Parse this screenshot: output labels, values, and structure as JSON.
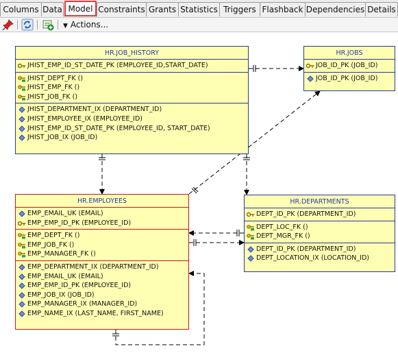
{
  "tabs": [
    "Columns",
    "Data",
    "Model",
    "Constraints",
    "Grants",
    "Statistics",
    "Triggers",
    "Flashback",
    "Dependencies",
    "Details"
  ],
  "toolbar": {
    "actions_label": "Actions...",
    "icons": [
      "pin-icon",
      "refresh-icon",
      "add-icon"
    ]
  },
  "colors": {
    "table_fill": "#ffffb4",
    "table_border_blue": "#243a9a",
    "table_border_red": "#c11b1b",
    "title_text": "#1f3bb0",
    "active_tab_border": "#e23b3b"
  },
  "tables": {
    "job_history": {
      "title": "HR.JOB_HISTORY",
      "pk": [
        "JHIST_EMP_ID_ST_DATE_PK (EMPLOYEE_ID,START_DATE)"
      ],
      "fk": [
        "JHIST_DEPT_FK ()",
        "JHIST_EMP_FK ()",
        "JHIST_JOB_FK ()"
      ],
      "idx": [
        "JHIST_DEPARTMENT_IX (DEPARTMENT_ID)",
        "JHIST_EMPLOYEE_IX (EMPLOYEE_ID)",
        "JHIST_EMP_ID_ST_DATE_PK (EMPLOYEE_ID, START_DATE)",
        "JHIST_JOB_IX (JOB_ID)"
      ]
    },
    "jobs": {
      "title": "HR.JOBS",
      "pk": [
        "JOB_ID_PK (JOB_ID)"
      ],
      "idx": [
        "JOB_ID_PK (JOB_ID)"
      ]
    },
    "employees": {
      "title": "HR.EMPLOYEES",
      "keys": [
        "EMP_EMAIL_UK (EMAIL)",
        "EMP_EMP_ID_PK (EMPLOYEE_ID)"
      ],
      "fk": [
        "EMP_DEPT_FK ()",
        "EMP_JOB_FK ()",
        "EMP_MANAGER_FK ()"
      ],
      "idx": [
        "EMP_DEPARTMENT_IX (DEPARTMENT_ID)",
        "EMP_EMAIL_UK (EMAIL)",
        "EMP_EMP_ID_PK (EMPLOYEE_ID)",
        "EMP_JOB_IX (JOB_ID)",
        "EMP_MANAGER_IX (MANAGER_ID)",
        "EMP_NAME_IX (LAST_NAME, FIRST_NAME)"
      ]
    },
    "departments": {
      "title": "HR.DEPARTMENTS",
      "pk": [
        "DEPT_ID_PK (DEPARTMENT_ID)"
      ],
      "fk": [
        "DEPT_LOC_FK ()",
        "DEPT_MGR_FK ()"
      ],
      "idx": [
        "DEPT_ID_PK (DEPARTMENT_ID)",
        "DEPT_LOCATION_IX (LOCATION_ID)"
      ]
    }
  }
}
